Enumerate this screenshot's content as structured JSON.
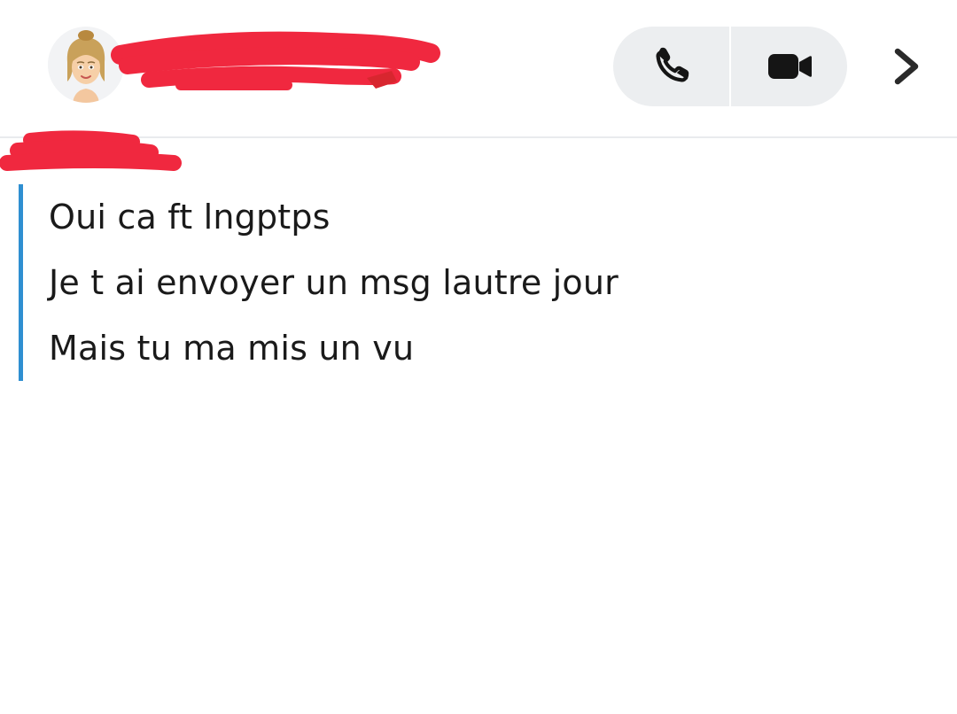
{
  "header": {
    "contact_name": "",
    "avatar_icon": "bitmoji-avatar-icon",
    "actions": [
      {
        "name": "voice-call",
        "icon": "phone-icon"
      },
      {
        "name": "video-call",
        "icon": "video-camera-icon"
      }
    ],
    "chevron_icon": "chevron-right-icon",
    "redaction_color": "#f0283f"
  },
  "conversation": {
    "sender_name": "",
    "accent_color": "#2f8fd1",
    "messages": [
      {
        "text": "Oui ca ft lngptps"
      },
      {
        "text": "Je t ai envoyer un msg lautre jour"
      },
      {
        "text": "Mais tu ma mis un vu"
      }
    ]
  }
}
